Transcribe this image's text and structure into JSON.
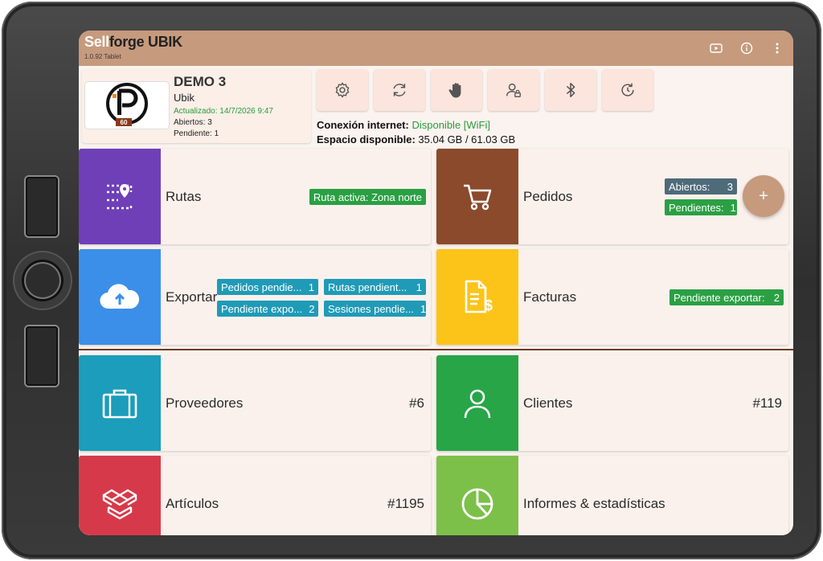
{
  "app": {
    "title_sell": "Sell",
    "title_rest": "forge UBIK",
    "version": "1.0.92 Tablet",
    "actions": [
      "play-video-icon",
      "info-icon",
      "more-vert-icon"
    ]
  },
  "company": {
    "logo_text": "60",
    "name": "DEMO 3",
    "subtitle": "Ubik",
    "updated": "Actualizado: 14/7/2026 9:47",
    "open": "Abiertos: 3",
    "pending": "Pendiente: 1"
  },
  "toolbar": {
    "buttons": [
      "settings-icon",
      "sync-icon",
      "hand-icon",
      "user-lock-icon",
      "bluetooth-icon",
      "history-icon"
    ]
  },
  "status": {
    "net_label": "Conexión internet:",
    "net_value": "Disponible [WiFi]",
    "space_label": "Espacio disponible:",
    "space_value": "35.04 GB / 61.03 GB"
  },
  "tiles": {
    "rutas": {
      "label": "Rutas",
      "chip": "Ruta activa: Zona norte",
      "color": "#6f3fb8"
    },
    "pedidos": {
      "label": "Pedidos",
      "chip_open_label": "Abiertos:",
      "chip_open_n": "3",
      "chip_pend_label": "Pendientes:",
      "chip_pend_n": "1",
      "fab": "+",
      "color": "#8b4a2b"
    },
    "exportar": {
      "label": "Exportar",
      "chips": [
        {
          "label": "Pedidos pendie...",
          "n": "1"
        },
        {
          "label": "Rutas pendient...",
          "n": "1"
        },
        {
          "label": "Pendiente expo...",
          "n": "2"
        },
        {
          "label": "Sesiones pendie...",
          "n": "1"
        }
      ],
      "color": "#3b8fe8"
    },
    "facturas": {
      "label": "Facturas",
      "chip_label": "Pendiente exportar:",
      "chip_n": "2",
      "color": "#fcc419"
    },
    "proveedores": {
      "label": "Proveedores",
      "count": "#6",
      "color": "#1b9dbb"
    },
    "clientes": {
      "label": "Clientes",
      "count": "#119",
      "color": "#27a547"
    },
    "articulos": {
      "label": "Artículos",
      "count": "#1195",
      "color": "#d63a4a"
    },
    "informes": {
      "label": "Informes & estadísticas",
      "color": "#7cc04a"
    }
  }
}
